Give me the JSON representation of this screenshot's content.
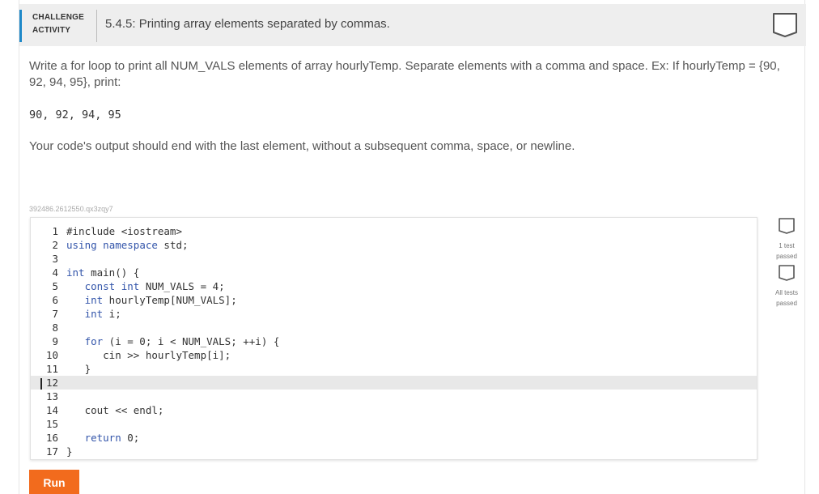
{
  "header": {
    "label_line1": "CHALLENGE",
    "label_line2": "ACTIVITY",
    "title": "5.4.5: Printing array elements separated by commas."
  },
  "prompt": {
    "text": "Write a for loop to print all NUM_VALS elements of array hourlyTemp. Separate elements with a comma and space. Ex: If hourlyTemp = {90, 92, 94, 95}, print:",
    "example": "90, 92, 94, 95",
    "note": "Your code's output should end with the last element, without a subsequent comma, space, or newline."
  },
  "editor": {
    "meta": "392486.2612550.qx3zqy7",
    "lines": [
      {
        "num": "1",
        "code": "#include <iostream>"
      },
      {
        "num": "2",
        "code": "using namespace std;"
      },
      {
        "num": "3",
        "code": ""
      },
      {
        "num": "4",
        "code": "int main() {"
      },
      {
        "num": "5",
        "code": "   const int NUM_VALS = 4;"
      },
      {
        "num": "6",
        "code": "   int hourlyTemp[NUM_VALS];"
      },
      {
        "num": "7",
        "code": "   int i;"
      },
      {
        "num": "8",
        "code": ""
      },
      {
        "num": "9",
        "code": "   for (i = 0; i < NUM_VALS; ++i) {"
      },
      {
        "num": "10",
        "code": "      cin >> hourlyTemp[i];"
      },
      {
        "num": "11",
        "code": "   }"
      },
      {
        "num": "12",
        "code": ""
      },
      {
        "num": "13",
        "code": ""
      },
      {
        "num": "14",
        "code": "   cout << endl;"
      },
      {
        "num": "15",
        "code": ""
      },
      {
        "num": "16",
        "code": "   return 0;"
      },
      {
        "num": "17",
        "code": "}"
      }
    ]
  },
  "tests": [
    {
      "label_line1": "1 test",
      "label_line2": "passed"
    },
    {
      "label_line1": "All tests",
      "label_line2": "passed"
    }
  ],
  "run_label": "Run",
  "colors": {
    "accent": "#1e88c8",
    "run_button": "#f26b1d",
    "header_bg": "#eeeeee"
  }
}
